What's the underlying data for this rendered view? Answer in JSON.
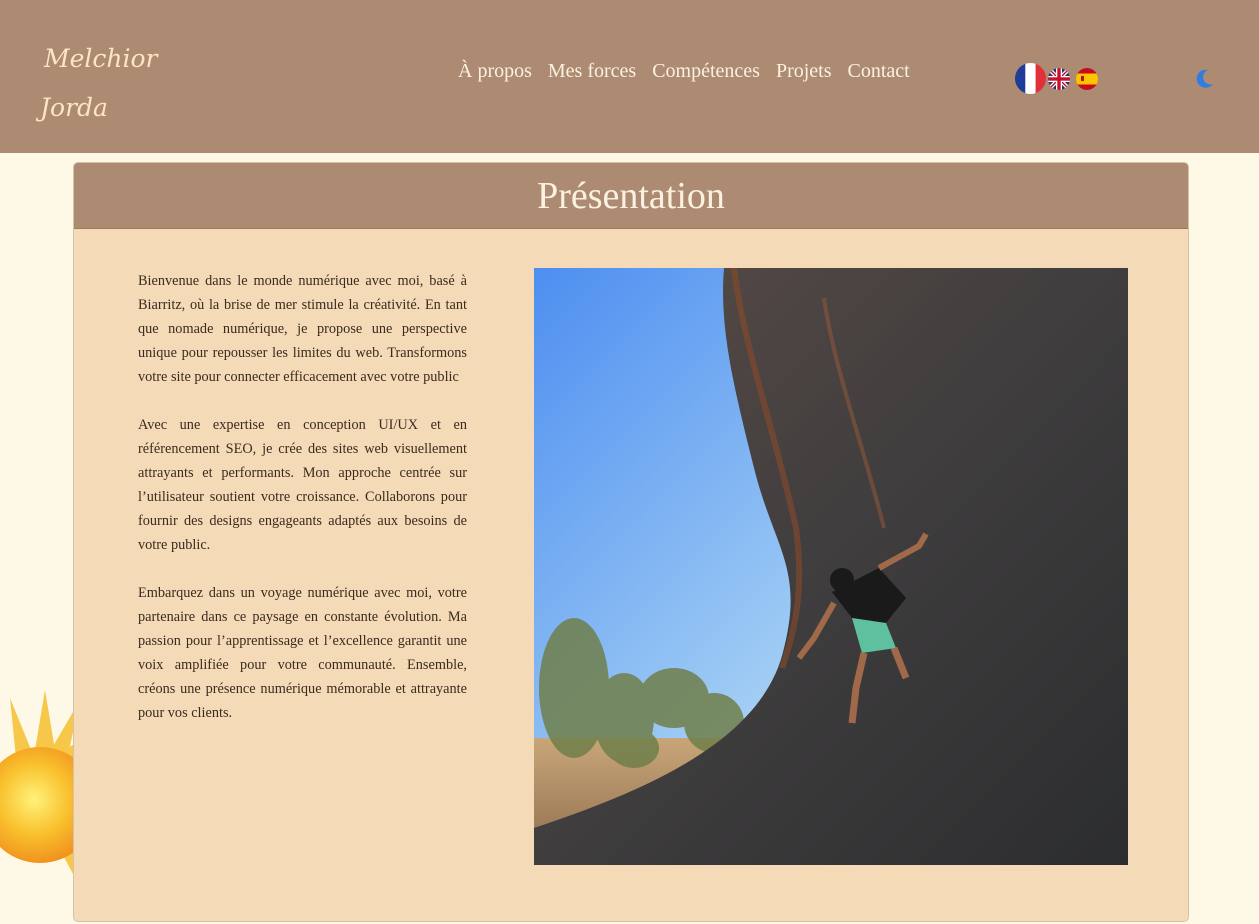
{
  "header": {
    "logo_line1": "Melchior",
    "logo_line2": "Jorda",
    "nav": [
      "À propos",
      "Mes forces",
      "Compétences",
      "Projets",
      "Contact"
    ],
    "languages": [
      "fr-flag-icon",
      "gb-flag-icon",
      "es-flag-icon"
    ],
    "theme_toggle_icon": "moon-icon"
  },
  "section": {
    "title": "Présentation",
    "paragraphs": [
      "Bienvenue dans le monde numérique avec moi, basé à Biarritz, où la brise de mer stimule la créativité. En tant que nomade numérique, je propose une perspective unique pour repousser les limites du web. Transformons votre site pour connecter efficacement avec votre public",
      "Avec une expertise en conception UI/UX et en référencement SEO, je crée des sites web visuellement attrayants et performants. Mon approche centrée sur l’utilisateur soutient votre croissance. Collaborons pour fournir des designs engageants adaptés aux besoins de votre public.",
      "Embarquez dans un voyage numérique avec moi, votre partenaire dans ce paysage en constante évolution. Ma passion pour l’apprentissage et l’excellence garantit une voix amplifiée pour votre communauté. Ensemble, créons une présence numérique mémorable et attrayante pour vos clients."
    ]
  },
  "colors": {
    "header_bg": "#ad8a72",
    "page_bg": "#fdf9e6",
    "card_bg": "#f5dab7",
    "nav_text": "#fbf1e0",
    "moon": "#2f7de0"
  }
}
